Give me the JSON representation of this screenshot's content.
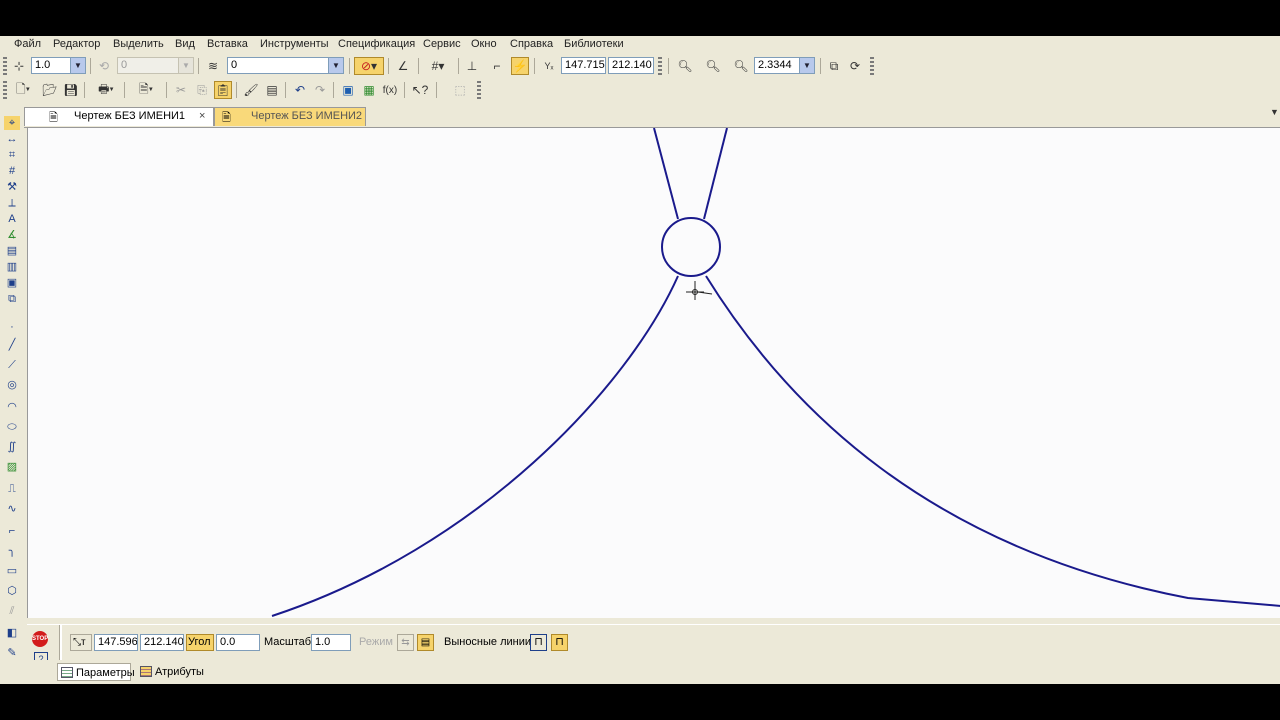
{
  "menu": [
    "Файл",
    "Редактор",
    "Выделить",
    "Вид",
    "Вставка",
    "Инструменты",
    "Спецификация",
    "Сервис",
    "Окно",
    "Справка",
    "Библиотеки"
  ],
  "toolbar1": {
    "step_value": "1.0",
    "layer_state_value": "0",
    "layer_value": "0",
    "coord_x": "147.715",
    "coord_y": "212.140",
    "coord_label": "Yₓ",
    "zoom_value": "2.3344"
  },
  "tabs": [
    {
      "label": "Чертеж БЕЗ ИМЕНИ1",
      "close": "×",
      "active": true
    },
    {
      "label": "Чертеж БЕЗ ИМЕНИ2",
      "active": false
    }
  ],
  "properties": {
    "point_label": "т",
    "x_value": "147.596",
    "y_value": "212.140",
    "angle_label": "Угол",
    "angle_value": "0.0",
    "scale_label": "Масштаб",
    "scale_value": "1.0",
    "mode_label": "Режим",
    "extension_lines_label": "Выносные линии",
    "stop_label": "STOP",
    "help_label": "?"
  },
  "bottom_tabs": [
    "Параметры",
    "Атрибуты"
  ],
  "colors": {
    "curve": "#1a1a8c",
    "accent": "#f6d36b",
    "chrome": "#ece9d8"
  },
  "icons": [
    "new-file-icon",
    "open-icon",
    "save-icon",
    "print-icon",
    "preview-icon",
    "cut-icon",
    "copy-icon",
    "paste-icon",
    "undo-icon",
    "redo-icon",
    "grid-icon",
    "zoom-in-icon",
    "zoom-out-icon",
    "refresh-icon",
    "help-icon"
  ]
}
